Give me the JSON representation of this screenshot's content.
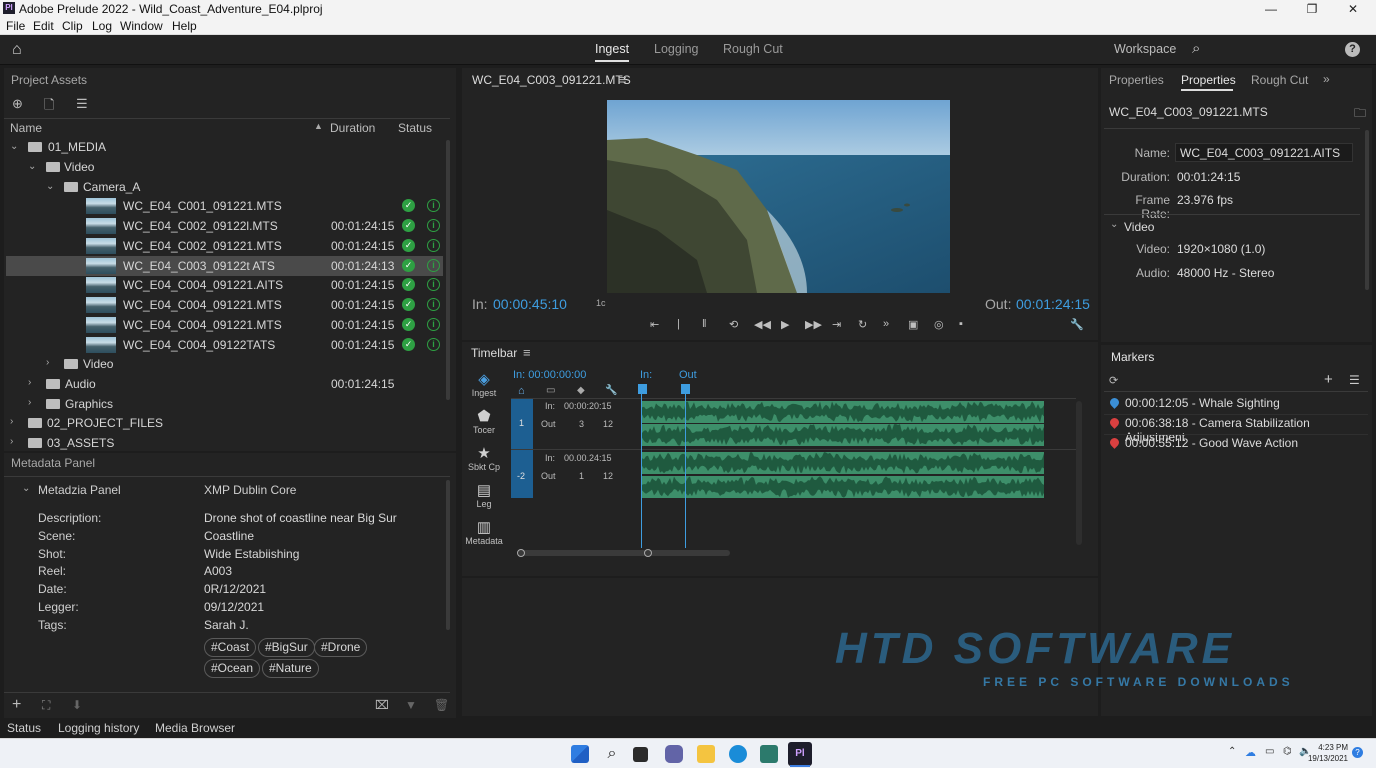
{
  "window": {
    "title": "Adobe Prelude 2022 - Wild_Coast_Adventure_E04.plproj",
    "logo": "Pl"
  },
  "menu": [
    "File",
    "Edit",
    "Clip",
    "Log",
    "Window",
    "Help"
  ],
  "workspace_tabs": [
    "Ingest",
    "Logging",
    "Rough Cut"
  ],
  "workspace_label": "Workspace",
  "project": {
    "title": "Project Assets",
    "col_name": "Name",
    "col_duration": "Duration",
    "col_status": "Status",
    "folders": {
      "media": "01_MEDIA",
      "video": "Video",
      "camera": "Camera_A",
      "video2": "Video",
      "audio": "Audio",
      "graphics": "Graphics",
      "project_files": "02_PROJECT_FILES",
      "assets": "03_ASSETS"
    },
    "audio_duration": "00:01:24:15",
    "clips": [
      {
        "name": "WC_E04_C001_091221.MTS",
        "duration": ""
      },
      {
        "name": "WC_E04_C002_09122l.MTS",
        "duration": "00:01:24:15"
      },
      {
        "name": "WC_E04_C002_091221.MTS",
        "duration": "00:01:24:15"
      },
      {
        "name": "WC_E04_C003_09122t ATS",
        "duration": "00:01:24:13"
      },
      {
        "name": "WC_E04_C004_091221.AITS",
        "duration": "00:01:24:15"
      },
      {
        "name": "WC_E04_C004_091221.MTS",
        "duration": "00:01:24:15"
      },
      {
        "name": "WC_E04_C004_091221.MTS",
        "duration": "00:01:24:15"
      },
      {
        "name": "WC_E04_C004_09122TATS",
        "duration": "00:01:24:15"
      }
    ]
  },
  "metadata": {
    "title": "Metadata Panel",
    "section": "Metadzia Panel",
    "schema": "XMP Dublin Core",
    "fields": [
      {
        "label": "Description:",
        "value": "Drone shot of coastline near Big Sur"
      },
      {
        "label": "Scene:",
        "value": "Coastline"
      },
      {
        "label": "Shot:",
        "value": "Wide Estabiishing"
      },
      {
        "label": "Reel:",
        "value": "A003"
      },
      {
        "label": "Date:",
        "value": "0R/12/2021"
      },
      {
        "label": "Legger:",
        "value": "09/12/2021"
      },
      {
        "label": "Tags:",
        "value": "Sarah J."
      }
    ],
    "tags": [
      "#Coast",
      "#BigSur",
      "#Drone",
      "#Ocean",
      "#Nature"
    ]
  },
  "bottom_tabs": [
    "Status",
    "Logging history",
    "Media Browser"
  ],
  "monitor": {
    "clip": "WC_E04_C003_091221.MTS",
    "in_label": "In:",
    "in_tc": "00:00:45:10",
    "rate": "1c",
    "out_label": "Out:",
    "out_tc": "00:01:24:15"
  },
  "timeline": {
    "title": "Timelbar",
    "playhead": "In: 00:00:00:00",
    "in_marker": "In:",
    "out_marker": "Out",
    "tools": [
      "Ingest",
      "Tocer",
      "Sbkt Cp",
      "Leg",
      "Metadata"
    ],
    "tracks": [
      {
        "num": "1",
        "in": "In:",
        "tc": "00:00:20:15",
        "out": "Out",
        "a": "3",
        "b": "12"
      },
      {
        "num": "-2",
        "in": "In:",
        "tc": "00.00.24:15",
        "out": "Out",
        "a": "1",
        "b": "12"
      }
    ],
    "wave_color": "#3d8f6a"
  },
  "properties": {
    "tabs": [
      "Properties",
      "Properties",
      "Rough Cut"
    ],
    "clip": "WC_E04_C003_091221.MTS",
    "name_label": "Name:",
    "name_value": "WC_E04_C003_091221.AITS",
    "duration_label": "Duration:",
    "duration_value": "00:01:24:15",
    "framerate_label": "Frame Rate:",
    "framerate_value": "23.976 fps",
    "video_section": "Video",
    "video_label": "Video:",
    "video_value": "1920×1080 (1.0)",
    "audio_label": "Audio:",
    "audio_value": "48000 Hz - Stereo"
  },
  "markers": {
    "title": "Markers",
    "items": [
      {
        "text": "00:00:12:05 - Whale Sighting",
        "color": "#3b8fd6"
      },
      {
        "text": "00:06:38:18 - Camera Stabilization Adjustment",
        "color": "#d94040"
      },
      {
        "text": "00:00:55:12 - Good Wave Action",
        "color": "#d94040"
      }
    ]
  },
  "watermark": {
    "line1": "HTD SOFTWARE",
    "line2": "FREE PC SOFTWARE DOWNLOADS"
  },
  "clock": {
    "time": "4:23 PM",
    "date": "19/13/2021"
  }
}
